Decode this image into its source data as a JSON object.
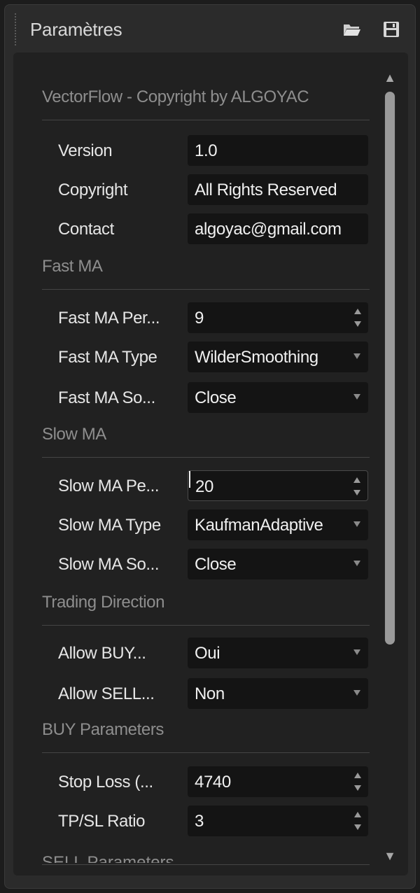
{
  "panel": {
    "title": "Paramètres",
    "icons": [
      "folder-open-icon",
      "save-icon"
    ]
  },
  "sections": [
    {
      "header": "VectorFlow - Copyright by ALGOYAC",
      "rows": [
        {
          "label": "Version",
          "value": "1.0",
          "control": "text"
        },
        {
          "label": "Copyright",
          "value": "All Rights Reserved",
          "control": "text"
        },
        {
          "label": "Contact",
          "value": "algoyac@gmail.com",
          "control": "text"
        }
      ]
    },
    {
      "header": "Fast MA",
      "rows": [
        {
          "label": "Fast MA Per...",
          "value": "9",
          "control": "spinner"
        },
        {
          "label": "Fast MA Type",
          "value": "WilderSmoothing",
          "control": "dropdown"
        },
        {
          "label": "Fast MA So...",
          "value": "Close",
          "control": "dropdown"
        }
      ]
    },
    {
      "header": "Slow MA",
      "rows": [
        {
          "label": "Slow MA Pe...",
          "value": "20",
          "control": "spinner",
          "focused": true
        },
        {
          "label": "Slow MA Type",
          "value": "KaufmanAdaptive",
          "control": "dropdown"
        },
        {
          "label": "Slow MA So...",
          "value": "Close",
          "control": "dropdown"
        }
      ]
    },
    {
      "header": "Trading Direction",
      "rows": [
        {
          "label": "Allow BUY...",
          "value": "Oui",
          "control": "dropdown"
        },
        {
          "label": "Allow SELL...",
          "value": "Non",
          "control": "dropdown"
        }
      ]
    },
    {
      "header": "BUY Parameters",
      "rows": [
        {
          "label": "Stop Loss (...",
          "value": "4740",
          "control": "spinner"
        },
        {
          "label": "TP/SL Ratio",
          "value": "3",
          "control": "spinner"
        }
      ]
    }
  ],
  "next_section_partial": "SELL Parameters",
  "colors": {
    "panel_bg": "#2b2b2b",
    "inner_bg": "#212121",
    "field_bg": "#141414",
    "text": "#e6e6e6",
    "section_text": "#8e8e8e"
  }
}
